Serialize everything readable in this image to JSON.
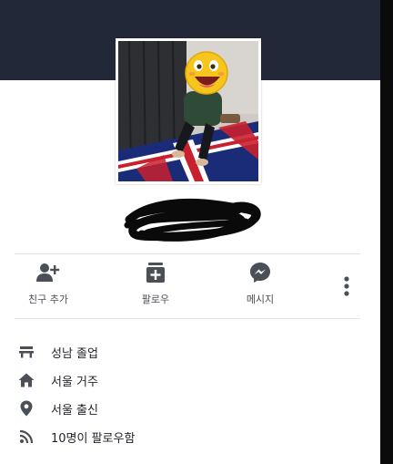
{
  "profile": {
    "photo_alt": "profile photo"
  },
  "actions": [
    {
      "label": "친구 추가",
      "icon": "add-friend-icon"
    },
    {
      "label": "팔로우",
      "icon": "follow-icon"
    },
    {
      "label": "메시지",
      "icon": "messenger-icon"
    }
  ],
  "more_icon": "more-vertical-icon",
  "info": [
    {
      "text": "성남 졸업",
      "icon": "education-icon"
    },
    {
      "text": "서울 거주",
      "icon": "home-icon"
    },
    {
      "text": "서울 출신",
      "icon": "location-pin-icon"
    },
    {
      "text": "10명이 팔로우함",
      "icon": "rss-feed-icon"
    }
  ],
  "colors": {
    "header": "#232838",
    "icon": "#4b4f56",
    "text": "#1d2129"
  }
}
